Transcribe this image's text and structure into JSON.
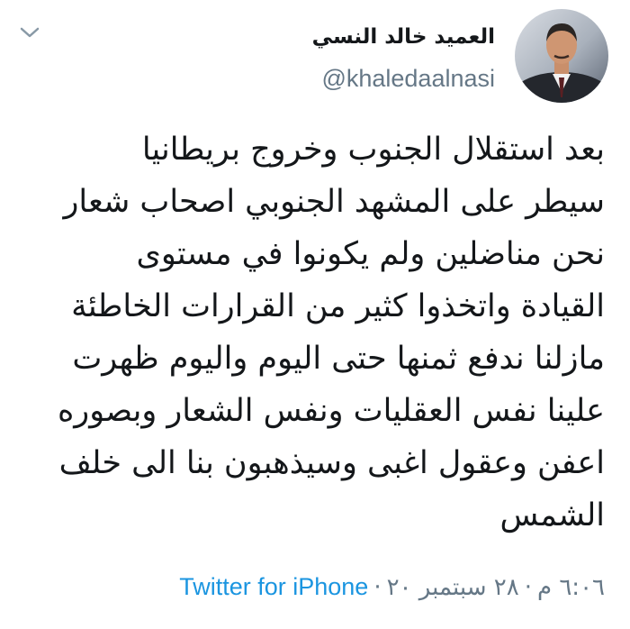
{
  "user": {
    "display_name": "العميد خالد النسي",
    "handle": "@khaledaalnasi",
    "avatar_icon": "user-portrait-icon"
  },
  "menu": {
    "icon": "chevron-down-icon"
  },
  "tweet": {
    "lines": [
      "بعد استقلال الجنوب وخروج بريطانيا",
      "سيطر على المشهد الجنوبي اصحاب شعار",
      "نحن مناضلين ولم يكونوا في مستوى",
      "القيادة واتخذوا كثير من القرارات الخاطئة",
      "مازلنا ندفع ثمنها حتى اليوم واليوم ظهرت",
      "علينا نفس العقليات ونفس الشعار وبصوره",
      "اعفن وعقول اغبى وسيذهبون بنا الى خلف",
      "الشمس"
    ],
    "time": "٦:٠٦ م",
    "date": "٢٨ سبتمبر ٢٠",
    "separator": "·",
    "source": "Twitter for iPhone"
  },
  "colors": {
    "text": "#14171a",
    "secondary": "#657786",
    "link": "#1b95e0"
  }
}
